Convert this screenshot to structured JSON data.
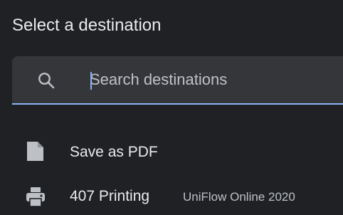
{
  "dialog": {
    "title": "Select a destination",
    "background_color": "#202124",
    "accent_color": "#8ab4f8"
  },
  "search": {
    "icon": "search-icon",
    "value": "",
    "placeholder": "Search destinations"
  },
  "destinations": [
    {
      "icon": "pdf-file-icon",
      "label": "Save as PDF",
      "sublabel": ""
    },
    {
      "icon": "printer-icon",
      "label": "407 Printing",
      "sublabel": "UniFlow Online 2020"
    }
  ]
}
